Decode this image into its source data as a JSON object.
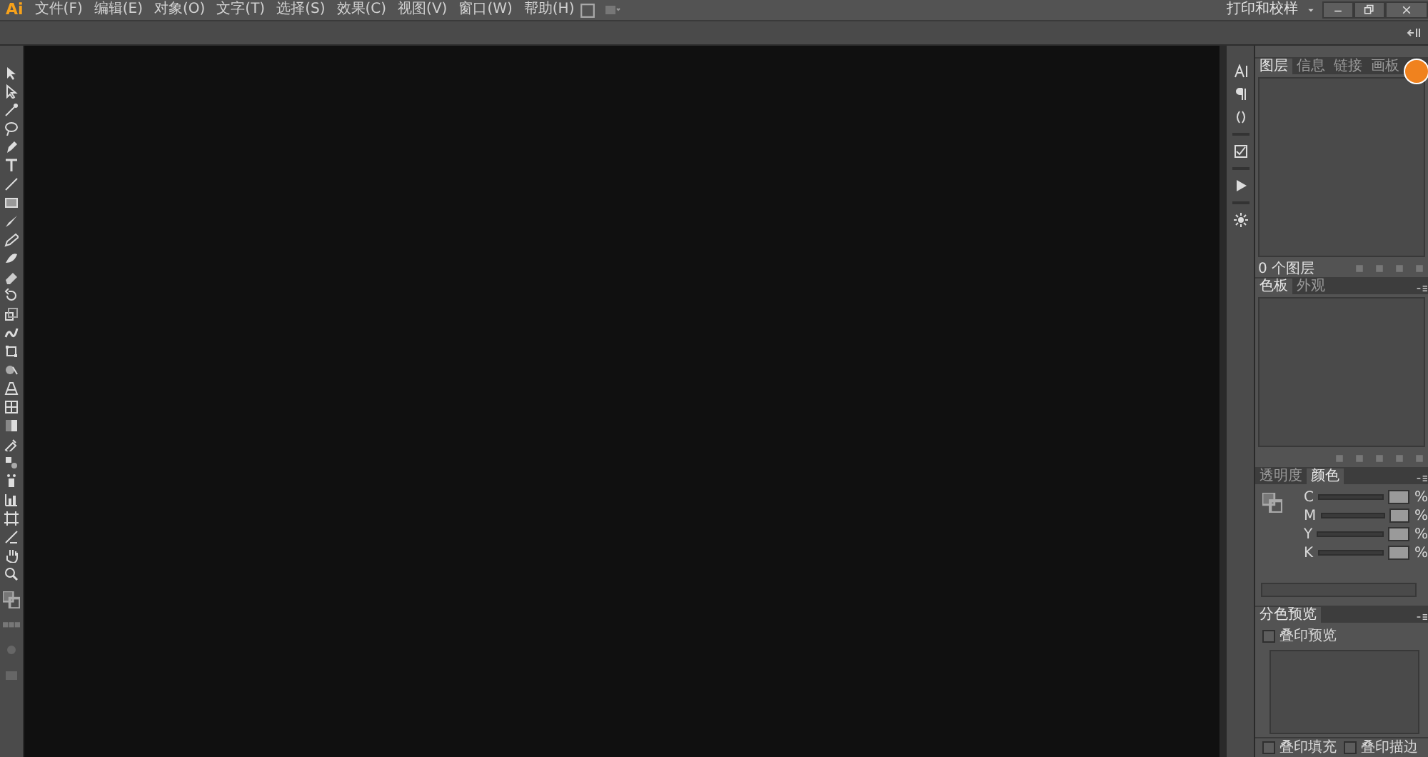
{
  "app": {
    "logo": "Ai"
  },
  "menu": [
    {
      "label": "文件(F)"
    },
    {
      "label": "编辑(E)"
    },
    {
      "label": "对象(O)"
    },
    {
      "label": "文字(T)"
    },
    {
      "label": "选择(S)"
    },
    {
      "label": "效果(C)"
    },
    {
      "label": "视图(V)"
    },
    {
      "label": "窗口(W)"
    },
    {
      "label": "帮助(H)"
    }
  ],
  "workspace": {
    "label": "打印和校样"
  },
  "layers_panel": {
    "tabs": [
      {
        "label": "图层",
        "selected": true
      },
      {
        "label": "信息",
        "selected": false
      },
      {
        "label": "链接",
        "selected": false
      },
      {
        "label": "画板",
        "selected": false
      }
    ],
    "count": "0 个图层"
  },
  "swatches_panel": {
    "tabs": [
      {
        "label": "色板",
        "selected": true
      },
      {
        "label": "外观",
        "selected": false
      }
    ]
  },
  "color_panel": {
    "tabs": [
      {
        "label": "透明度",
        "selected": false
      },
      {
        "label": "颜色",
        "selected": true
      }
    ],
    "channels": [
      {
        "name": "C",
        "unit": "%"
      },
      {
        "name": "M",
        "unit": "%"
      },
      {
        "name": "Y",
        "unit": "%"
      },
      {
        "name": "K",
        "unit": "%"
      }
    ]
  },
  "separations_panel": {
    "tabs": [
      {
        "label": "分色预览",
        "selected": true
      }
    ],
    "overprint_preview": {
      "label": "叠印预览",
      "checked": false
    }
  },
  "attributes_bar": {
    "options": [
      {
        "label": "叠印填充",
        "checked": false
      },
      {
        "label": "叠印描边",
        "checked": false
      }
    ]
  }
}
